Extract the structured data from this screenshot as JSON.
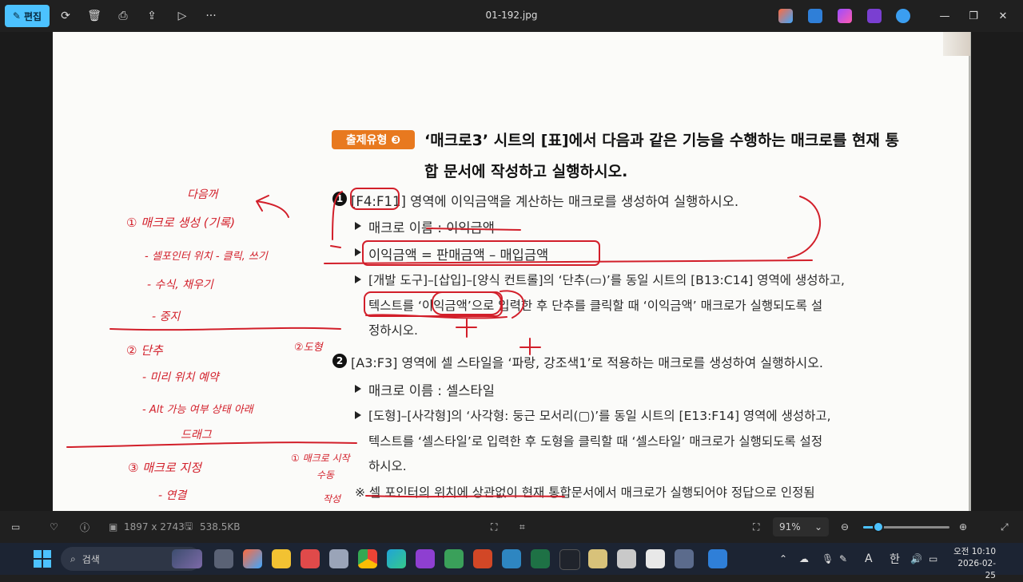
{
  "titlebar": {
    "edit_label": "편집",
    "file_name": "01-192.jpg"
  },
  "document": {
    "badge": "출제유형 ❸",
    "heading_line1": "‘매크로3’ 시트의 [표]에서 다음과 같은 기능을 수행하는 매크로를 현재 통",
    "heading_line2": "합 문서에 작성하고 실행하시오.",
    "item1_number": "1",
    "item1_text": "[F4:F11] 영역에 이익금액을 계산하는 매크로를 생성하여 실행하시오.",
    "item1_b1": "매크로 이름 : 이익금액",
    "item1_b2": "이익금액 = 판매금액 – 매입금액",
    "item1_b3_l1": "[개발 도구]–[삽입]–[양식 컨트롤]의 ‘단추(▭)’를 동일 시트의 [B13:C14] 영역에 생성하고,",
    "item1_b3_l2": "텍스트를 ‘이익금액’으로 입력한 후 단추를 클릭할 때 ‘이익금액’ 매크로가 실행되도록 설",
    "item1_b3_l3": "정하시오.",
    "item2_number": "2",
    "item2_text": "[A3:F3] 영역에 셀 스타일을 ‘파랑, 강조색1’로 적용하는 매크로를 생성하여 실행하시오.",
    "item2_b1": "매크로 이름 : 셀스타일",
    "item2_b2_l1": "[도형]–[사각형]의 ‘사각형: 둥근 모서리(▢)’를 동일 시트의 [E13:F14] 영역에 생성하고,",
    "item2_b2_l2": "텍스트를 ‘셀스타일’로 입력한 후 도형을 클릭할 때 ‘셀스타일’ 매크로가 실행되도록 설정",
    "item2_b2_l3": "하시오.",
    "note": "※ 셀 포인터의 위치에 상관없이 현재 통합문서에서 매크로가 실행되어야 정답으로 인정됨"
  },
  "handwriting": {
    "h1": "다음꺼",
    "h2": "① 매크로 생성 (기록)",
    "h3": "- 셀포인터 위치 - 클릭, 쓰기",
    "h4": "- 수식, 채우기",
    "h5": "- 중지",
    "h6": "② 단추",
    "h7": "- 미리 위치 예약",
    "h8": "- Alt 가능 여부 상태 아래",
    "h9": "드래그",
    "h10": "③ 매크로 지정",
    "h11": "- 연결",
    "h12": "②도형",
    "h13": "① 매크로 시작",
    "h14": "수동",
    "h15": "작성"
  },
  "statusbar": {
    "dimensions": "1897 x 2743",
    "filesize": "538.5KB",
    "zoom": "91%",
    "zoom_fraction": 0.18
  },
  "taskbar": {
    "search_label": "검색",
    "ime": "한",
    "input_mode": "A",
    "time": "오전 10:10",
    "date": "2026-02-25"
  },
  "colors": {
    "accent": "#4cc2ff",
    "badge": "#e8791f",
    "ink": "#d21f2a"
  }
}
